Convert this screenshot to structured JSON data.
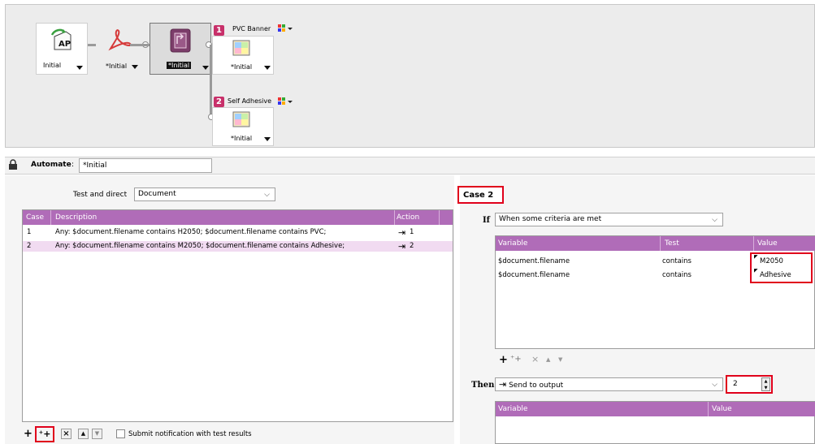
{
  "workflow": {
    "nodes": [
      {
        "label": "Initial",
        "icon": "automate-ap-icon"
      },
      {
        "label": "*Initial",
        "icon": "pdf-icon"
      },
      {
        "label": "*Initial",
        "icon": "flow-switch-icon"
      },
      {
        "label": "*Initial",
        "icon": "output-icon"
      }
    ],
    "branch1": {
      "number": "1",
      "name": "PVC Banner"
    },
    "branch2": {
      "number": "2",
      "name": "Self Adhesive",
      "node_label": "*Initial"
    }
  },
  "automate": {
    "label": "Automate",
    "separator": ":",
    "value": "*Initial"
  },
  "test": {
    "label": "Test and direct",
    "value": "Document"
  },
  "cases_table": {
    "headers": {
      "case": "Case",
      "description": "Description",
      "action": "Action"
    },
    "rows": [
      {
        "case": "1",
        "description": "Any: $document.filename contains H2050; $document.filename contains PVC;",
        "action_icon": "⇥",
        "action": "1"
      },
      {
        "case": "2",
        "description": "Any: $document.filename contains M2050; $document.filename contains Adhesive;",
        "action_icon": "⇥",
        "action": "2"
      }
    ]
  },
  "left_toolbar": {
    "notify_label": "Submit notification with test results"
  },
  "case_detail": {
    "title": "Case 2",
    "if_label": "If",
    "if_value": "When some criteria are met",
    "criteria_headers": {
      "variable": "Variable",
      "test": "Test",
      "value": "Value"
    },
    "criteria_rows": [
      {
        "variable": "$document.filename",
        "test": "contains",
        "value": "M2050"
      },
      {
        "variable": "$document.filename",
        "test": "contains",
        "value": "Adhesive"
      }
    ],
    "then_label": "Then",
    "then_value": "Send to output",
    "output_number": "2",
    "output_headers": {
      "variable": "Variable",
      "value": "Value"
    }
  },
  "colors": {
    "accent": "#b06cb8",
    "highlight": "#e0001b",
    "badge": "#c8306a",
    "selected_row": "#f1dbf1"
  }
}
